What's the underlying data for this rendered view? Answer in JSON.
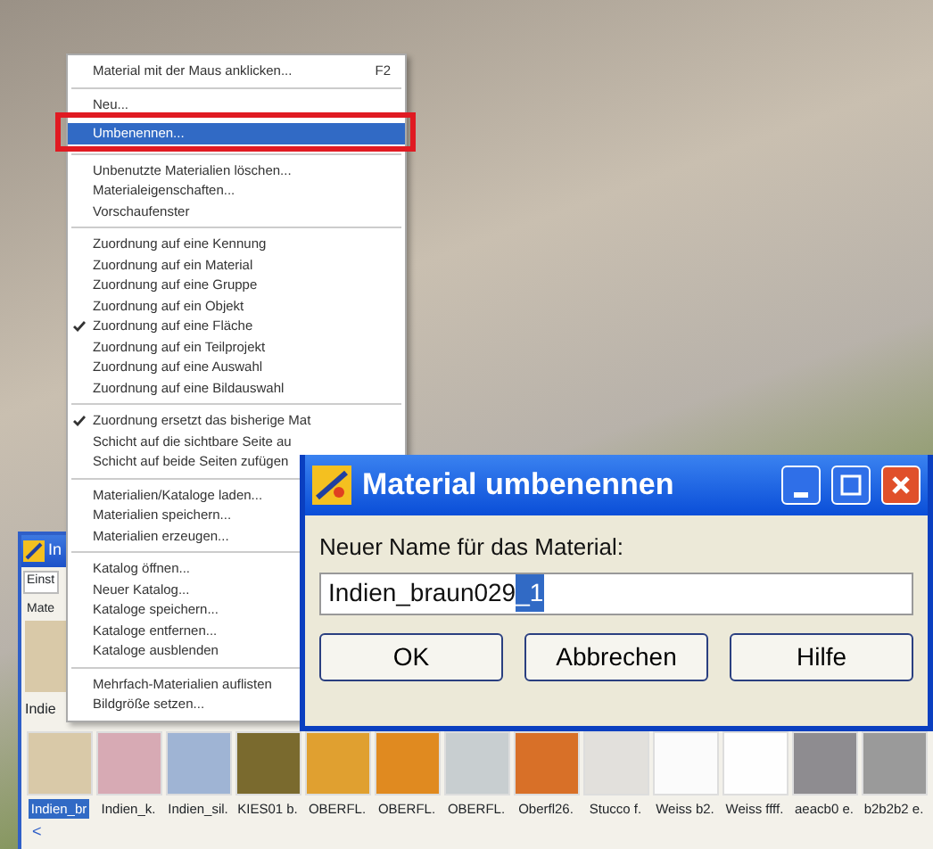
{
  "context_menu": {
    "items": [
      {
        "kind": "item",
        "label": "Material mit der Maus anklicken...",
        "shortcut": "F2",
        "checked": false,
        "selected": false
      },
      {
        "kind": "separator"
      },
      {
        "kind": "item",
        "label": "Neu...",
        "checked": false,
        "selected": false
      },
      {
        "kind": "item",
        "label": "Umbenennen...",
        "checked": false,
        "selected": true
      },
      {
        "kind": "separator"
      },
      {
        "kind": "item",
        "label": "Unbenutzte Materialien löschen...",
        "checked": false,
        "selected": false
      },
      {
        "kind": "item",
        "label": "Materialeigenschaften...",
        "checked": false,
        "selected": false
      },
      {
        "kind": "item",
        "label": "Vorschaufenster",
        "checked": false,
        "selected": false
      },
      {
        "kind": "separator"
      },
      {
        "kind": "item",
        "label": "Zuordnung auf eine Kennung",
        "checked": false,
        "selected": false
      },
      {
        "kind": "item",
        "label": "Zuordnung auf ein Material",
        "checked": false,
        "selected": false
      },
      {
        "kind": "item",
        "label": "Zuordnung auf eine Gruppe",
        "checked": false,
        "selected": false
      },
      {
        "kind": "item",
        "label": "Zuordnung auf ein Objekt",
        "checked": false,
        "selected": false
      },
      {
        "kind": "item",
        "label": "Zuordnung auf eine Fläche",
        "checked": true,
        "selected": false
      },
      {
        "kind": "item",
        "label": "Zuordnung auf ein Teilprojekt",
        "checked": false,
        "selected": false
      },
      {
        "kind": "item",
        "label": "Zuordnung auf eine Auswahl",
        "checked": false,
        "selected": false
      },
      {
        "kind": "item",
        "label": "Zuordnung auf eine Bildauswahl",
        "checked": false,
        "selected": false
      },
      {
        "kind": "separator"
      },
      {
        "kind": "item",
        "label": "Zuordnung ersetzt das bisherige Mat",
        "checked": true,
        "selected": false
      },
      {
        "kind": "item",
        "label": "Schicht auf die sichtbare Seite au",
        "checked": false,
        "selected": false
      },
      {
        "kind": "item",
        "label": "Schicht auf beide Seiten zufügen",
        "checked": false,
        "selected": false
      },
      {
        "kind": "separator"
      },
      {
        "kind": "item",
        "label": "Materialien/Kataloge laden...",
        "checked": false,
        "selected": false
      },
      {
        "kind": "item",
        "label": "Materialien speichern...",
        "checked": false,
        "selected": false
      },
      {
        "kind": "item",
        "label": "Materialien erzeugen...",
        "checked": false,
        "selected": false
      },
      {
        "kind": "separator"
      },
      {
        "kind": "item",
        "label": "Katalog öffnen...",
        "checked": false,
        "selected": false
      },
      {
        "kind": "item",
        "label": "Neuer Katalog...",
        "checked": false,
        "selected": false
      },
      {
        "kind": "item",
        "label": "Kataloge speichern...",
        "checked": false,
        "selected": false
      },
      {
        "kind": "item",
        "label": "Kataloge entfernen...",
        "checked": false,
        "selected": false
      },
      {
        "kind": "item",
        "label": "Kataloge ausblenden",
        "checked": false,
        "selected": false
      },
      {
        "kind": "separator"
      },
      {
        "kind": "item",
        "label": "Mehrfach-Materialien auflisten",
        "checked": false,
        "selected": false
      },
      {
        "kind": "item",
        "label": "Bildgröße setzen...",
        "checked": false,
        "selected": false
      }
    ]
  },
  "material_panel": {
    "title": "In",
    "tab": "Einst",
    "section": "Mate",
    "preview_label": "Indie",
    "scroll_arrow": "<",
    "thumbnails": [
      {
        "label": "Indien_br",
        "color": "#d9c9a8",
        "selected": true
      },
      {
        "label": "Indien_k.",
        "color": "#d7aab4",
        "selected": false
      },
      {
        "label": "Indien_sil.",
        "color": "#9fb4d4",
        "selected": false
      },
      {
        "label": "KIES01 b.",
        "color": "#7a6a2e",
        "selected": false
      },
      {
        "label": "OBERFL.",
        "color": "#e0a030",
        "selected": false
      },
      {
        "label": "OBERFL.",
        "color": "#e08a20",
        "selected": false
      },
      {
        "label": "OBERFL.",
        "color": "#c8ced0",
        "selected": false
      },
      {
        "label": "Oberfl26.",
        "color": "#d87028",
        "selected": false
      },
      {
        "label": "Stucco f.",
        "color": "#e2e0dc",
        "selected": false
      },
      {
        "label": "Weiss b2.",
        "color": "#fbfbfb",
        "selected": false
      },
      {
        "label": "Weiss ffff.",
        "color": "#fefefe",
        "selected": false
      },
      {
        "label": "aeacb0 e.",
        "color": "#8e8c90",
        "selected": false
      },
      {
        "label": "b2b2b2 e.",
        "color": "#9a9a9a",
        "selected": false
      }
    ]
  },
  "dialog": {
    "title": "Material umbenennen",
    "label": "Neuer Name für das Material:",
    "value": "Indien_braun029",
    "selected_text": "_1",
    "buttons": [
      "OK",
      "Abbrechen",
      "Hilfe"
    ]
  }
}
